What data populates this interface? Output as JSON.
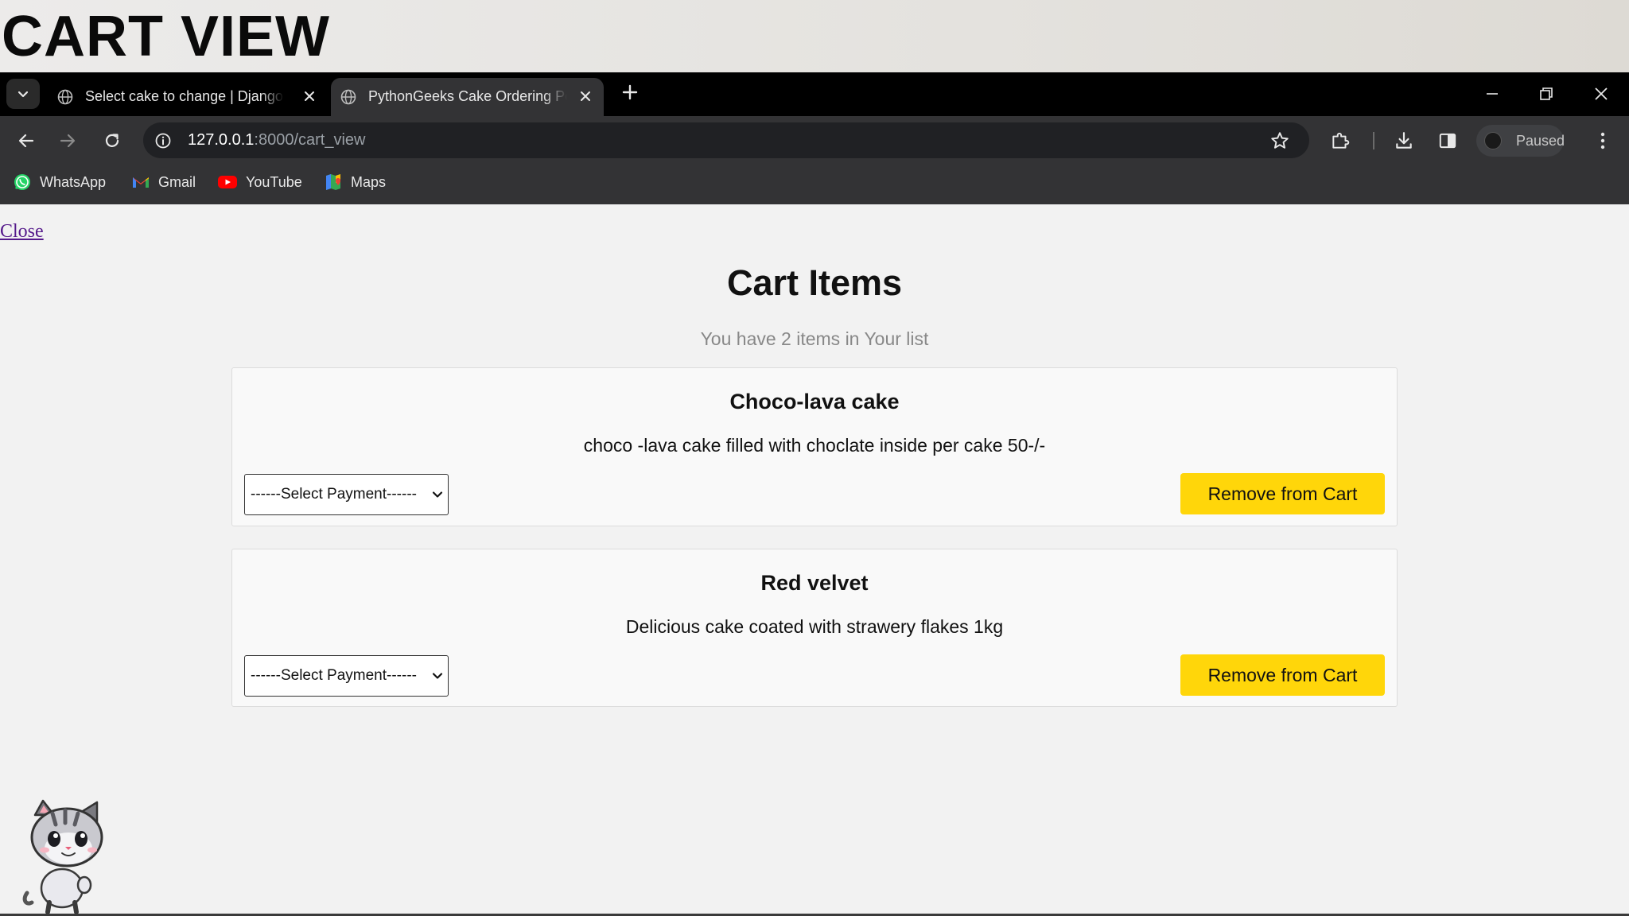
{
  "banner": {
    "title": "CART VIEW"
  },
  "browser": {
    "tabs": [
      {
        "label": "Select cake to change | Django",
        "active": false
      },
      {
        "label": "PythonGeeks Cake Ordering Portal",
        "active": true
      }
    ],
    "url": {
      "host": "127.0.0.1",
      "rest": ":8000/cart_view"
    },
    "profile_status": "Paused",
    "bookmarks": [
      {
        "label": "WhatsApp",
        "icon": "whatsapp-icon"
      },
      {
        "label": "Gmail",
        "icon": "gmail-icon"
      },
      {
        "label": "YouTube",
        "icon": "youtube-icon"
      },
      {
        "label": "Maps",
        "icon": "maps-icon"
      }
    ]
  },
  "page": {
    "close_link": "Close",
    "title": "Cart Items",
    "count_text": "You have 2 items in Your list",
    "items": [
      {
        "name": "Choco-lava cake",
        "description": "choco -lava cake filled with choclate inside per cake 50-/-",
        "payment_select": "------Select Payment------",
        "remove_label": "Remove from Cart"
      },
      {
        "name": "Red velvet",
        "description": "Delicious cake coated with strawery flakes 1kg",
        "payment_select": "------Select Payment------",
        "remove_label": "Remove from Cart"
      }
    ]
  },
  "colors": {
    "remove_button": "#ffd60a",
    "browser_frame": "#333335",
    "tab_strip": "#000000",
    "link_visited": "#551a8b"
  }
}
